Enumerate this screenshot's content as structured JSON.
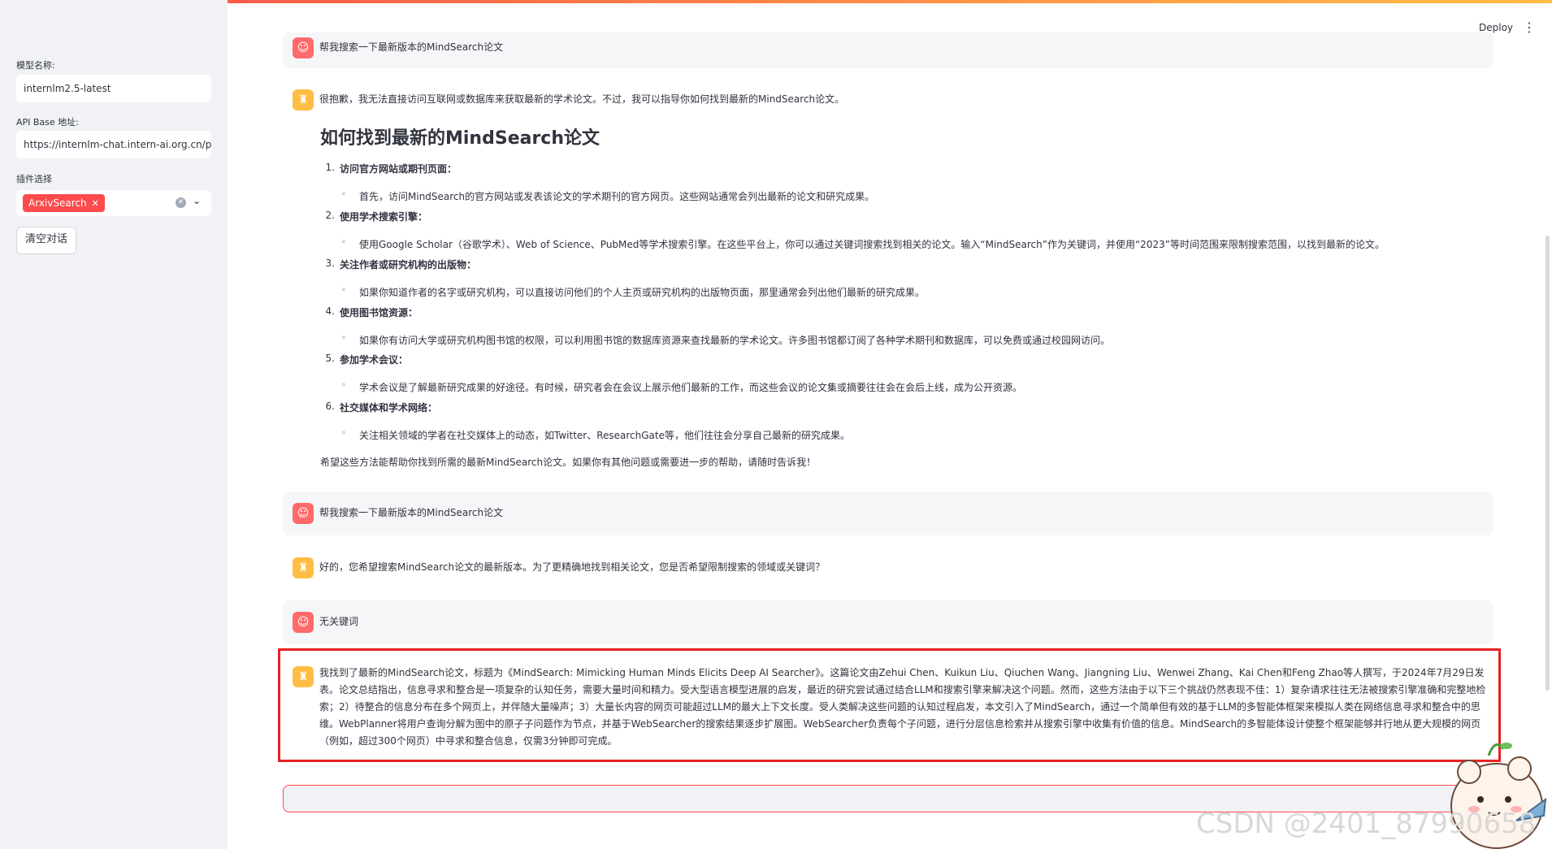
{
  "sidebar": {
    "model_label": "模型名称:",
    "model_value": "internlm2.5-latest",
    "api_label": "API Base 地址:",
    "api_value": "https://internlm-chat.intern-ai.org.cn/pu",
    "plugin_label": "插件选择",
    "plugin_tag": "ArxivSearch",
    "clear_button": "清空对话"
  },
  "header": {
    "deploy": "Deploy",
    "menu_icon": "⋮"
  },
  "messages": {
    "first_user": "帮我搜索一下最新版本的MindSearch论文",
    "answer_intro": "很抱歉，我无法直接访问互联网或数据库来获取最新的学术论文。不过，我可以指导你如何找到最新的MindSearch论文。",
    "answer_heading": "如何找到最新的MindSearch论文",
    "steps": [
      {
        "num": "1.",
        "title": "访问官方网站或期刊页面：",
        "detail": "首先，访问MindSearch的官方网站或发表该论文的学术期刊的官方网页。这些网站通常会列出最新的论文和研究成果。"
      },
      {
        "num": "2.",
        "title": "使用学术搜索引擎：",
        "detail": "使用Google Scholar（谷歌学术）、Web of Science、PubMed等学术搜索引擎。在这些平台上，你可以通过关键词搜索找到相关的论文。输入“MindSearch”作为关键词，并使用“2023”等时间范围来限制搜索范围，以找到最新的论文。"
      },
      {
        "num": "3.",
        "title": "关注作者或研究机构的出版物：",
        "detail": "如果你知道作者的名字或研究机构，可以直接访问他们的个人主页或研究机构的出版物页面，那里通常会列出他们最新的研究成果。"
      },
      {
        "num": "4.",
        "title": "使用图书馆资源：",
        "detail": "如果你有访问大学或研究机构图书馆的权限，可以利用图书馆的数据库资源来查找最新的学术论文。许多图书馆都订阅了各种学术期刊和数据库，可以免费或通过校园网访问。"
      },
      {
        "num": "5.",
        "title": "参加学术会议：",
        "detail": "学术会议是了解最新研究成果的好途径。有时候，研究者会在会议上展示他们最新的工作，而这些会议的论文集或摘要往往会在会后上线，成为公开资源。"
      },
      {
        "num": "6.",
        "title": "社交媒体和学术网络：",
        "detail": "关注相关领域的学者在社交媒体上的动态，如Twitter、ResearchGate等，他们往往会分享自己最新的研究成果。"
      }
    ],
    "answer_closing": "希望这些方法能帮助你找到所需的最新MindSearch论文。如果你有其他问题或需要进一步的帮助，请随时告诉我！",
    "second_user": "帮我搜索一下最新版本的MindSearch论文",
    "clarify": "好的，您希望搜索MindSearch论文的最新版本。为了更精确地找到相关论文，您是否希望限制搜索的领域或关键词？",
    "third_user": "无关键词",
    "final_answer": "我找到了最新的MindSearch论文，标题为《MindSearch: Mimicking Human Minds Elicits Deep AI Searcher》。这篇论文由Zehui Chen、Kuikun Liu、Qiuchen Wang、Jiangning Liu、Wenwei Zhang、Kai Chen和Feng Zhao等人撰写，于2024年7月29日发表。论文总结指出，信息寻求和整合是一项复杂的认知任务，需要大量时间和精力。受大型语言模型进展的启发，最近的研究尝试通过结合LLM和搜索引擎来解决这个问题。然而，这些方法由于以下三个挑战仍然表现不佳：1）复杂请求往往无法被搜索引擎准确和完整地检索；2）待整合的信息分布在多个网页上，并伴随大量噪声；3）大量长内容的网页可能超过LLM的最大上下文长度。受人类解决这些问题的认知过程启发，本文引入了MindSearch，通过一个简单但有效的基于LLM的多智能体框架来模拟人类在网络信息寻求和整合中的思维。WebPlanner将用户查询分解为图中的原子子问题作为节点，并基于WebSearcher的搜索结果逐步扩展图。WebSearcher负责每个子问题，进行分层信息检索并从搜索引擎中收集有价值的信息。MindSearch的多智能体设计使整个框架能够并行地从更大规模的网页（例如，超过300个网页）中寻求和整合信息，仅需3分钟即可完成。"
  },
  "watermark": "CSDN @2401_87990658",
  "colors": {
    "accent": "#ff4b4b",
    "user_avatar": "#ff6b6b",
    "assistant_avatar": "#ffbd45",
    "highlight": "#e52222"
  }
}
